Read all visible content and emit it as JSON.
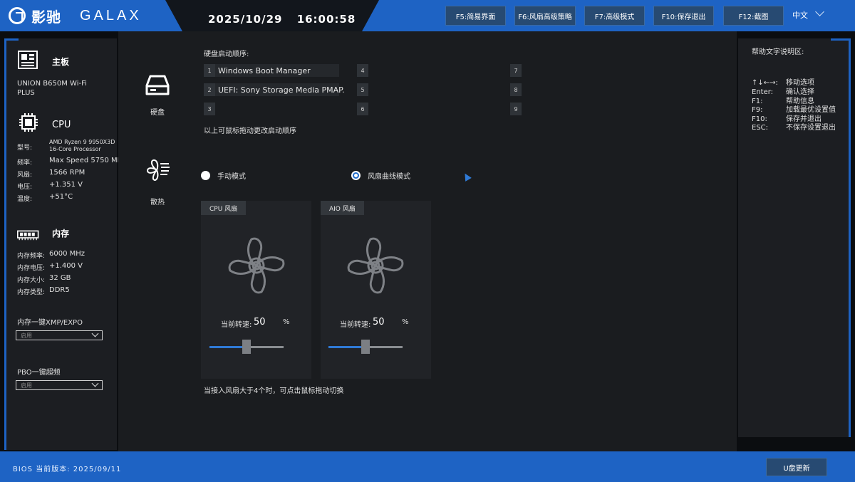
{
  "header": {
    "brand_cn": "影驰",
    "brand_en": "GALAX",
    "date": "2025/10/29",
    "time": "16:00:58",
    "fkeys": [
      {
        "label": "F5:简易界面"
      },
      {
        "label": "F6:风扇高级策略"
      },
      {
        "label": "F7:高级模式"
      },
      {
        "label": "F10:保存退出"
      },
      {
        "label": "F12:截图"
      }
    ],
    "language": "中文"
  },
  "sidebar": {
    "motherboard": {
      "heading": "主板",
      "model_line1": "UNION B650M Wi-Fi",
      "model_line2": "PLUS"
    },
    "cpu": {
      "heading": "CPU",
      "rows": [
        {
          "label": "型号:",
          "value": "AMD Ryzen 9 9950X3D",
          "value2": "16-Core Processor"
        },
        {
          "label": "频率:",
          "value": "Max Speed 5750 MHz"
        },
        {
          "label": "风扇:",
          "value": "1566 RPM"
        },
        {
          "label": "电压:",
          "value": "+1.351 V"
        },
        {
          "label": "温度:",
          "value": "+51°C"
        }
      ]
    },
    "memory": {
      "heading": "内存",
      "rows": [
        {
          "label": "内存频率:",
          "value": "6000 MHz"
        },
        {
          "label": "内存电压:",
          "value": "+1.400 V"
        },
        {
          "label": "内存大小:",
          "value": "32 GB"
        },
        {
          "label": "内存类型:",
          "value": "DDR5"
        }
      ]
    },
    "xmp": {
      "label": "内存一键XMP/EXPO",
      "value": "启用"
    },
    "pbo": {
      "label": "PBO一键超频",
      "value": "启用"
    }
  },
  "boot": {
    "icon_label": "硬盘",
    "title": "硬盘启动顺序:",
    "slots": [
      {
        "num": "1",
        "label": "Windows Boot Manager"
      },
      {
        "num": "2",
        "label": "UEFI: Sony Storage Media PMAP."
      },
      {
        "num": "3",
        "label": ""
      },
      {
        "num": "4",
        "label": ""
      },
      {
        "num": "5",
        "label": ""
      },
      {
        "num": "6",
        "label": ""
      },
      {
        "num": "7",
        "label": ""
      },
      {
        "num": "8",
        "label": ""
      },
      {
        "num": "9",
        "label": ""
      }
    ],
    "hint": "以上可鼠标拖动更改启动顺序"
  },
  "cooling": {
    "icon_label": "散热",
    "mode_manual": "手动模式",
    "mode_curve": "风扇曲线模式",
    "selected_mode": "curve",
    "fans": [
      {
        "name": "CPU 风扇",
        "speed_label": "当前转速:",
        "speed": "50",
        "unit": "%",
        "level": 0.5
      },
      {
        "name": "AIO 风扇",
        "speed_label": "当前转速:",
        "speed": "50",
        "unit": "%",
        "level": 0.5
      }
    ],
    "hint": "当接入风扇大于4个时，可点击鼠标拖动切换"
  },
  "help": {
    "title": "帮助文字说明区:",
    "lines": [
      {
        "key": "↑↓←→:",
        "desc": "移动选项"
      },
      {
        "key": "Enter:",
        "desc": "确认选择"
      },
      {
        "key": "F1:",
        "desc": "帮助信息"
      },
      {
        "key": "F9:",
        "desc": "加载最优设置值"
      },
      {
        "key": "F10:",
        "desc": "保存并退出"
      },
      {
        "key": "ESC:",
        "desc": "不保存设置退出"
      }
    ]
  },
  "footer": {
    "bios_label": "BIOS 当前版本:",
    "bios_version": "2025/09/11",
    "usb_update": "U盘更新"
  },
  "colors": {
    "accent": "#1e63c4",
    "button": "#274a72",
    "slider": "#2f7ad6"
  }
}
